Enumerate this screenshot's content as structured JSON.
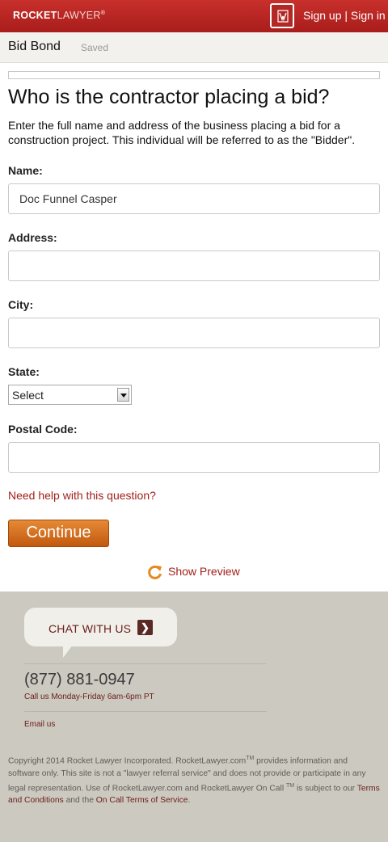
{
  "header": {
    "logo_bold": "ROCKET",
    "logo_light": "LAWYER",
    "logo_mark": "®",
    "doc_icon": "document-seal-icon",
    "signup_label": "Sign up",
    "separator": " | ",
    "signin_label": "Sign in"
  },
  "subbar": {
    "title": "Bid Bond",
    "status": "Saved"
  },
  "question": {
    "title": "Who is the contractor placing a bid?",
    "description": "Enter the full name and address of the business placing a bid for a construction project. This individual will be referred to as the \"Bidder\"."
  },
  "form": {
    "name_label": "Name:",
    "name_value": "Doc Funnel Casper",
    "address_label": "Address:",
    "address_value": "",
    "city_label": "City:",
    "city_value": "",
    "state_label": "State:",
    "state_value": "Select",
    "postal_label": "Postal Code:",
    "postal_value": ""
  },
  "help_link": "Need help with this question?",
  "continue_label": "Continue",
  "preview_label": "Show Preview",
  "footer": {
    "chat_label": "CHAT WITH US",
    "chat_arrow": "❯",
    "phone": "(877) 881-0947",
    "hours": "Call us Monday-Friday 6am-6pm PT",
    "email": "Email us",
    "copyright_1": "Copyright 2014 Rocket Lawyer Incorporated. RocketLawyer.com",
    "tm": "TM",
    "copyright_2": " provides information and software only. This site is not a \"lawyer referral service\" and does not provide or participate in any legal representation. Use of RocketLawyer.com and RocketLawyer On Call ",
    "copyright_3": " is subject to our ",
    "terms_link": "Terms and Conditions",
    "and_text": " and the ",
    "oncall_terms_link": "On Call Terms of Service",
    "period": "."
  },
  "colors": {
    "brand_red": "#b32724",
    "link_red": "#a3201c",
    "button_orange": "#d36f22",
    "footer_bg": "#ccc9c0"
  }
}
